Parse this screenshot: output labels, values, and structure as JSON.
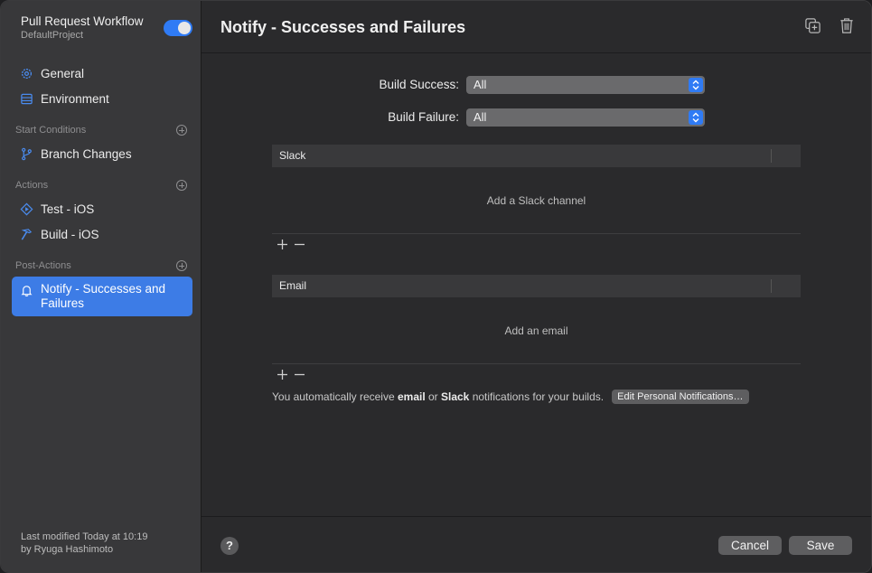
{
  "sidebar": {
    "workflow_title": "Pull Request Workflow",
    "project": "DefaultProject",
    "enabled": true,
    "items_top": [
      {
        "label": "General",
        "icon": "gear-icon"
      },
      {
        "label": "Environment",
        "icon": "environment-icon"
      }
    ],
    "sections": {
      "start": {
        "label": "Start Conditions",
        "items": [
          {
            "label": "Branch Changes",
            "icon": "branch-icon"
          }
        ]
      },
      "actions": {
        "label": "Actions",
        "items": [
          {
            "label": "Test - iOS",
            "icon": "play-icon"
          },
          {
            "label": "Build - iOS",
            "icon": "hammer-icon"
          }
        ]
      },
      "post": {
        "label": "Post-Actions",
        "items": [
          {
            "label": "Notify - Successes and Failures",
            "icon": "bell-icon"
          }
        ]
      }
    },
    "modified_line1": "Last modified Today at 10:19",
    "modified_line2": "by Ryuga Hashimoto"
  },
  "main": {
    "title": "Notify - Successes and Failures",
    "build_success_label": "Build Success:",
    "build_success_value": "All",
    "build_failure_label": "Build Failure:",
    "build_failure_value": "All",
    "slack": {
      "header": "Slack",
      "empty": "Add a Slack channel"
    },
    "email": {
      "header": "Email",
      "empty": "Add an email"
    },
    "notice": {
      "part1": "You automatically receive ",
      "bold1": "email",
      "part2": " or ",
      "bold2": "Slack",
      "part3": " notifications for your builds.",
      "button": "Edit Personal Notifications…"
    },
    "help_label": "?",
    "cancel_label": "Cancel",
    "save_label": "Save"
  },
  "colors": {
    "accent": "#3d7ce6",
    "toggle": "#2f7bf5"
  }
}
